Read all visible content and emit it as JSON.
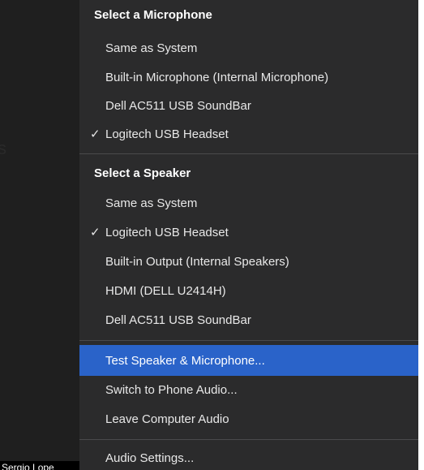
{
  "background": {
    "partial_letter": "s",
    "name_tag": "Sergio Lope"
  },
  "menu": {
    "microphone_section": {
      "title": "Select a Microphone",
      "items": [
        {
          "label": "Same as System",
          "checked": false
        },
        {
          "label": "Built-in Microphone (Internal Microphone)",
          "checked": false
        },
        {
          "label": "Dell AC511 USB SoundBar",
          "checked": false
        },
        {
          "label": "Logitech USB Headset",
          "checked": true
        }
      ]
    },
    "speaker_section": {
      "title": "Select a Speaker",
      "items": [
        {
          "label": "Same as System",
          "checked": false
        },
        {
          "label": "Logitech USB Headset",
          "checked": true
        },
        {
          "label": "Built-in Output (Internal Speakers)",
          "checked": false
        },
        {
          "label": "HDMI (DELL U2414H)",
          "checked": false
        },
        {
          "label": "Dell AC511 USB SoundBar",
          "checked": false
        }
      ]
    },
    "actions": [
      {
        "label": "Test Speaker & Microphone...",
        "highlighted": true
      },
      {
        "label": "Switch to Phone Audio...",
        "highlighted": false
      },
      {
        "label": "Leave Computer Audio",
        "highlighted": false
      }
    ],
    "settings": {
      "label": "Audio Settings..."
    },
    "check_glyph": "✓"
  },
  "colors": {
    "menu_background": "#2b2b2c",
    "highlight": "#2a63c9",
    "separator": "#4a4a4c"
  }
}
